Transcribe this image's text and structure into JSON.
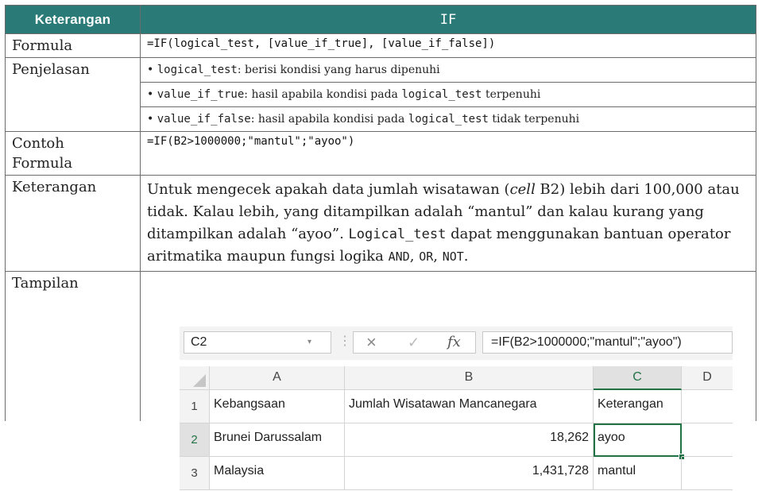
{
  "header": {
    "left": "Keterangan",
    "right": "IF"
  },
  "rows": {
    "formula_label": "Formula",
    "formula_value": "=IF(logical_test, [value_if_true], [value_if_false])",
    "penjelasan_label": "Penjelasan",
    "bullets": [
      {
        "bullet": "•",
        "code": "logical_test",
        "text1": ": berisi kondisi yang harus dipenuhi",
        "code2": "",
        "text2": ""
      },
      {
        "bullet": "•",
        "code": "value_if_true",
        "text1": ": hasil apabila kondisi pada ",
        "code2": "logical_test",
        "text2": " terpenuhi"
      },
      {
        "bullet": "•",
        "code": "value_if_false",
        "text1": ": hasil apabila kondisi pada ",
        "code2": "logical_test",
        "text2": " tidak terpenuhi"
      }
    ],
    "contoh_label_1": "Contoh",
    "contoh_label_2": "Formula",
    "contoh_value": "=IF(B2>1000000;\"mantul\";\"ayoo\")",
    "keterangan_label": "Keterangan",
    "keterangan_p1": "Untuk mengecek apakah data jumlah wisatawan (",
    "keterangan_cell": "cell",
    "keterangan_p2": " B2) lebih dari 100,000 atau tidak. Kalau lebih, yang ditampilkan adalah “mantul” dan kalau kurang yang ditampilkan adalah “ayoo”. ",
    "keterangan_code": "Logical_test",
    "keterangan_p3": " dapat menggunakan bantuan operator aritmatika maupun fungsi logika ",
    "op_and": "AND",
    "sep1": ",",
    "op_or": "OR",
    "sep2": ", ",
    "op_not": "NOT",
    "end": ".",
    "tampilan_label": "Tampilan"
  },
  "excel": {
    "name_box": "C2",
    "name_box_dropdown": "▾",
    "separator_dots": "⋮",
    "cancel_icon": "×",
    "enter_icon": "✓",
    "fx_icon": "fx",
    "formula": "=IF(B2>1000000;\"mantul\";\"ayoo\")",
    "columns": [
      "A",
      "B",
      "C",
      "D"
    ],
    "row_numbers": [
      "1",
      "2",
      "3"
    ],
    "cells": [
      [
        "Kebangsaan",
        "Jumlah Wisatawan Mancanegara",
        "Keterangan"
      ],
      [
        "Brunei Darussalam",
        "18,262",
        "ayoo"
      ],
      [
        "Malaysia",
        "1,431,728",
        "mantul"
      ]
    ],
    "active_cell": "C2",
    "accent_color": "#217346"
  },
  "colors": {
    "header_bg": "#2a7a78",
    "border": "#6b6b6b"
  }
}
